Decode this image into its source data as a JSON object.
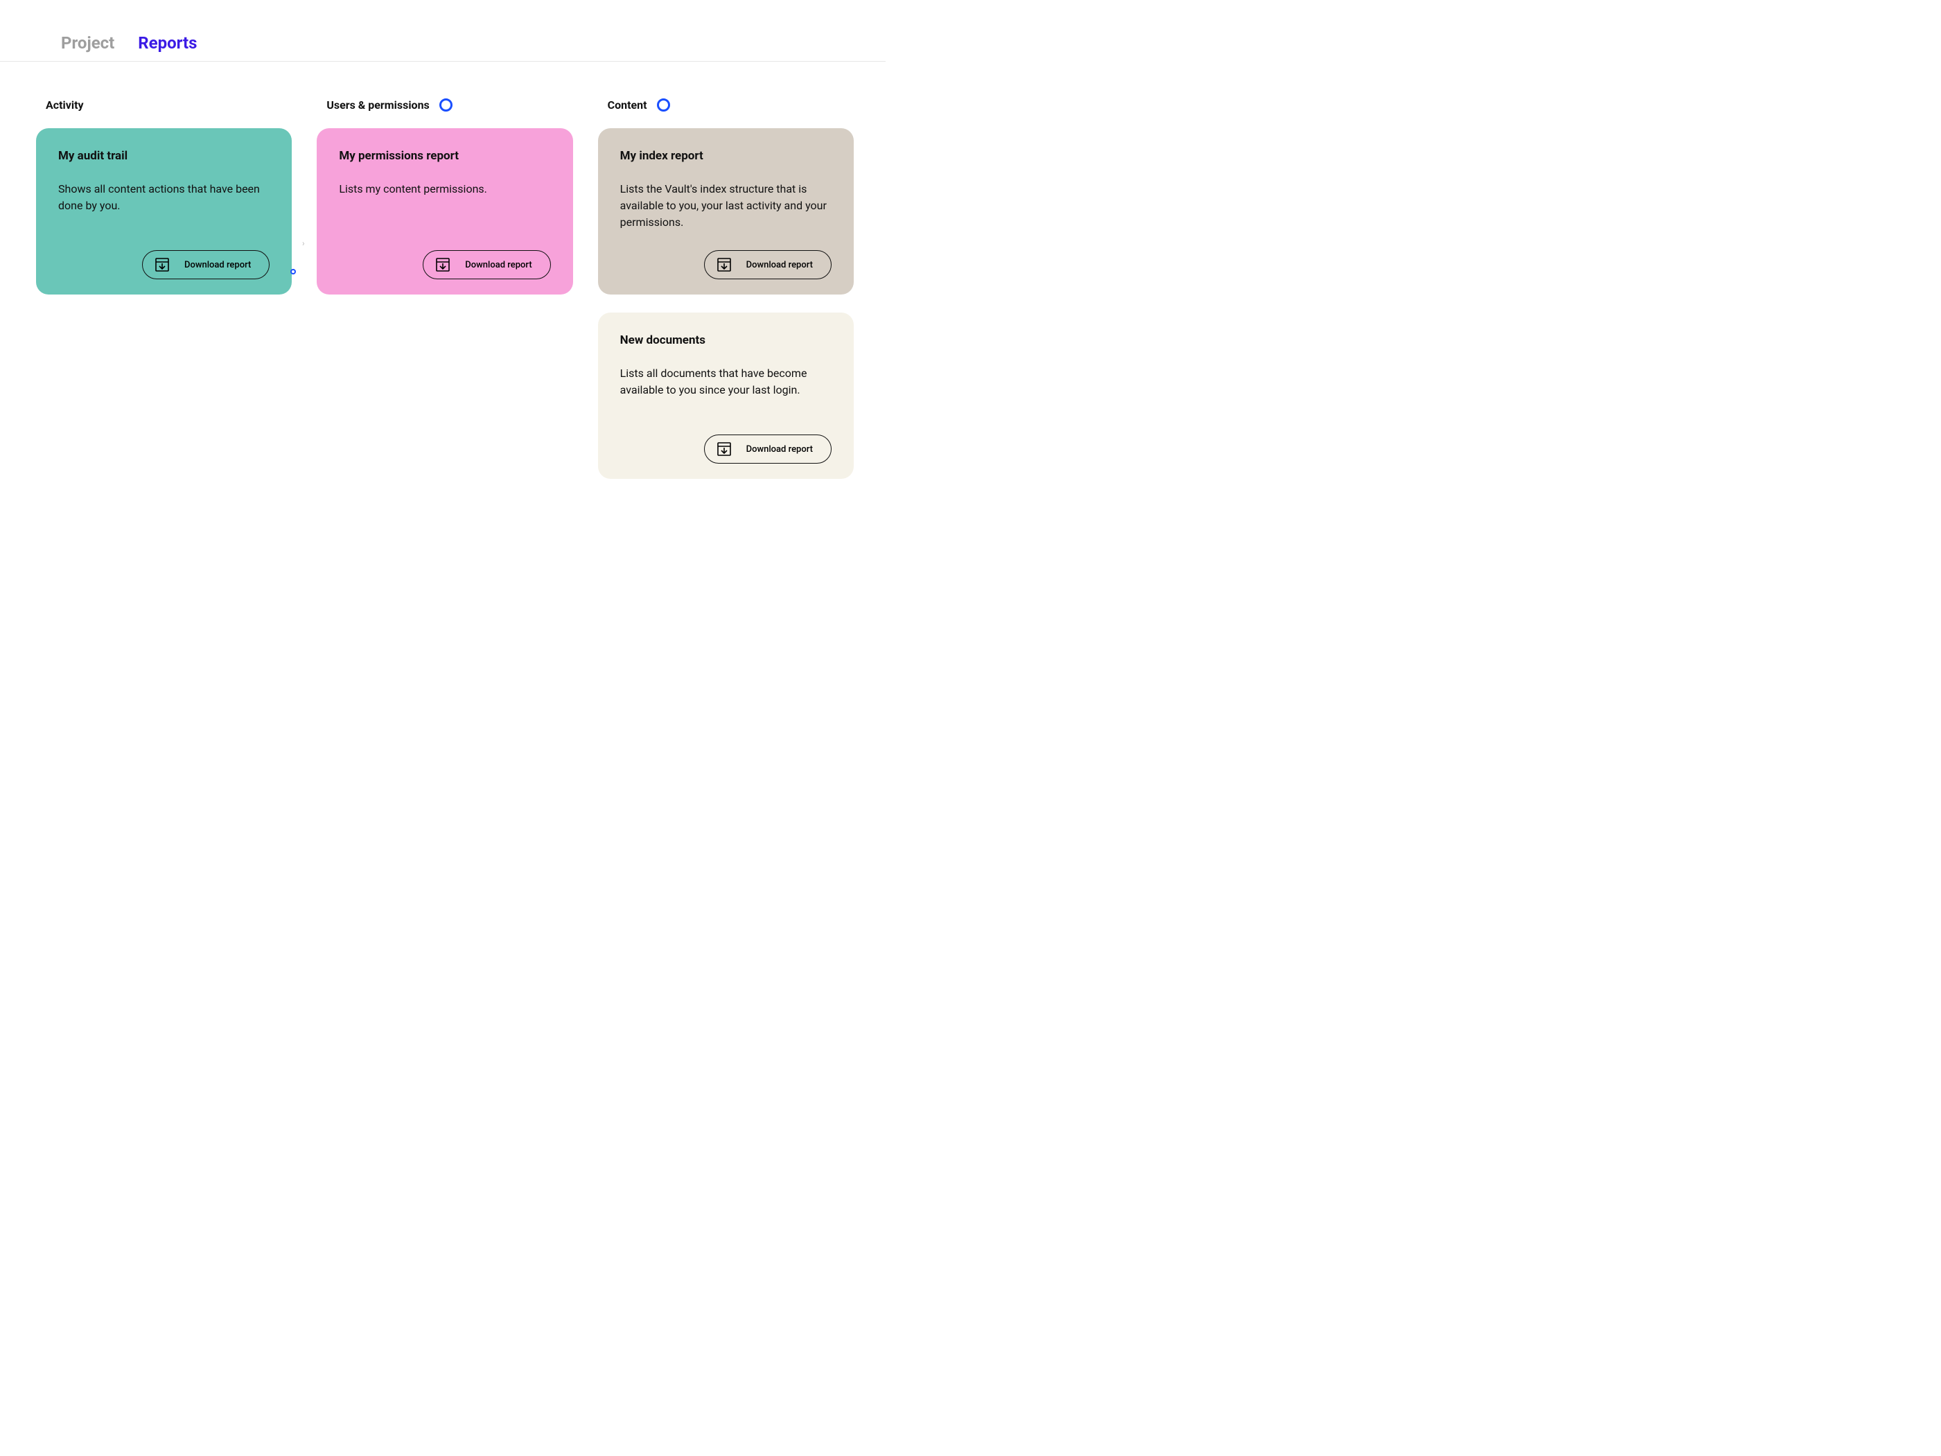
{
  "tabs": {
    "project": "Project",
    "reports": "Reports",
    "active": "reports"
  },
  "download_label": "Download report",
  "columns": [
    {
      "title": "Activity",
      "ring": false,
      "cards": [
        {
          "title": "My audit trail",
          "desc": "Shows all content actions that have been done by you.",
          "color": "teal"
        }
      ]
    },
    {
      "title": "Users & permissions",
      "ring": true,
      "cards": [
        {
          "title": "My permissions report",
          "desc": "Lists my content permissions.",
          "color": "pink"
        }
      ]
    },
    {
      "title": "Content",
      "ring": true,
      "cards": [
        {
          "title": "My index report",
          "desc": "Lists the Vault's index structure that is available to you, your last activity and your permissions.",
          "color": "taupe"
        },
        {
          "title": "New documents",
          "desc": "Lists all documents that have become available to you since your last login.",
          "color": "cream"
        }
      ]
    }
  ]
}
